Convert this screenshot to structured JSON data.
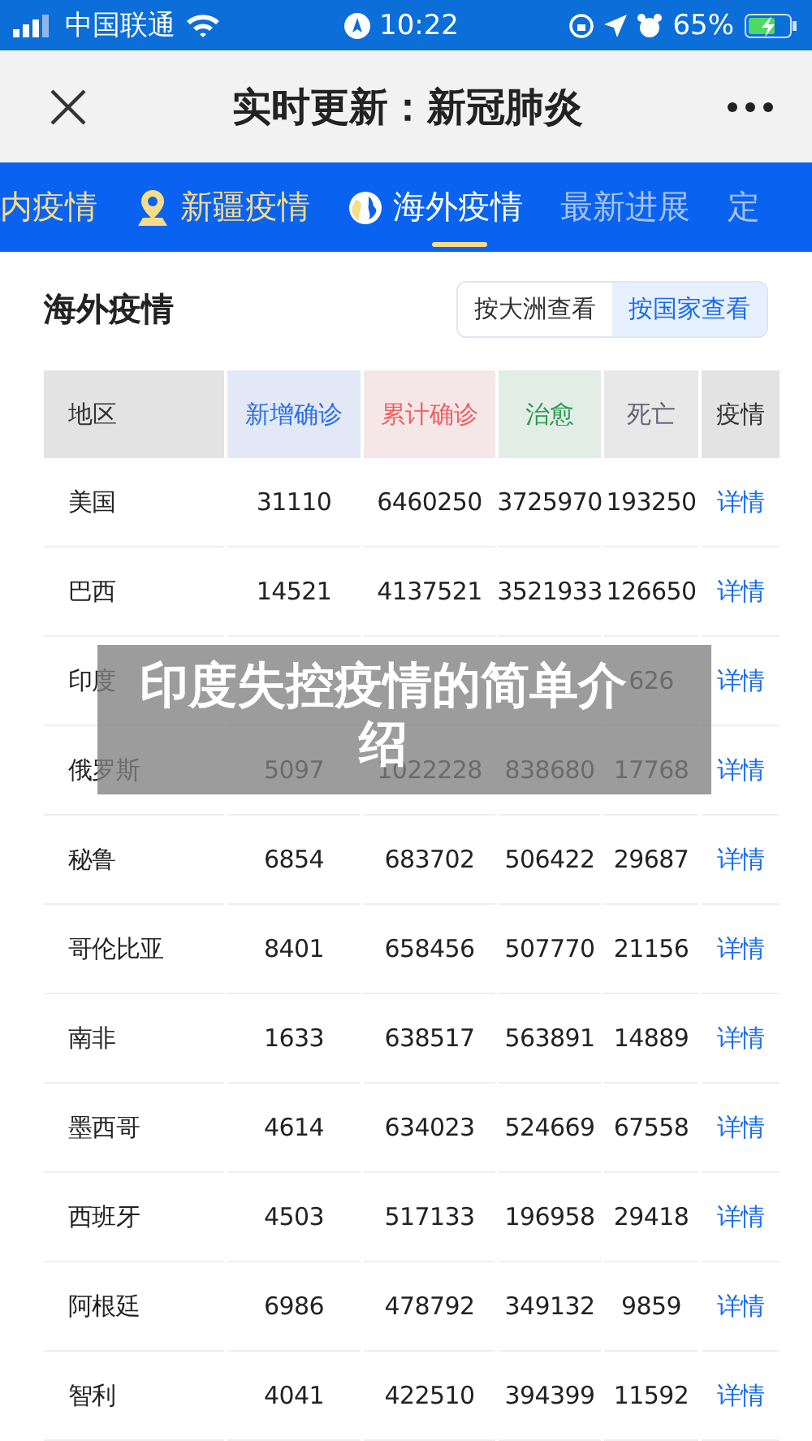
{
  "status_bar": {
    "carrier": "中国联通",
    "time": "10:22",
    "battery": "65%"
  },
  "nav": {
    "title": "实时更新：新冠肺炎"
  },
  "tabs": [
    {
      "label": "内疫情",
      "kind": "plain",
      "selected": false,
      "highlight": true
    },
    {
      "label": "新疆疫情",
      "kind": "pin",
      "selected": false,
      "highlight": true
    },
    {
      "label": "海外疫情",
      "kind": "globe",
      "selected": true,
      "highlight": false
    },
    {
      "label": "最新进展",
      "kind": "plain",
      "selected": false,
      "highlight": false
    },
    {
      "label": "定",
      "kind": "plain",
      "selected": false,
      "highlight": false
    }
  ],
  "section": {
    "title": "海外疫情",
    "toggle": [
      {
        "label": "按大洲查看",
        "selected": false
      },
      {
        "label": "按国家查看",
        "selected": true
      }
    ]
  },
  "table": {
    "columns": [
      {
        "label": "地区",
        "color": "#333333"
      },
      {
        "label": "新增确诊",
        "color": "#2a6ef0"
      },
      {
        "label": "累计确诊",
        "color": "#f06060"
      },
      {
        "label": "治愈",
        "color": "#2e9b54"
      },
      {
        "label": "死亡",
        "color": "#666677"
      },
      {
        "label": "疫情",
        "color": "#333333"
      }
    ],
    "rows": [
      {
        "cells": [
          "美国",
          "31110",
          "6460250",
          "3725970",
          "193250"
        ],
        "link": "详情"
      },
      {
        "cells": [
          "巴西",
          "14521",
          "4137521",
          "3521933",
          "126650"
        ],
        "link": "详情"
      },
      {
        "cells": [
          "印度",
          "",
          "",
          "",
          "626"
        ],
        "link": "详情"
      },
      {
        "cells": [
          "俄罗斯",
          "5097",
          "1022228",
          "838680",
          "17768"
        ],
        "link": "详情"
      },
      {
        "cells": [
          "秘鲁",
          "6854",
          "683702",
          "506422",
          "29687"
        ],
        "link": "详情"
      },
      {
        "cells": [
          "哥伦比亚",
          "8401",
          "658456",
          "507770",
          "21156"
        ],
        "link": "详情"
      },
      {
        "cells": [
          "南非",
          "1633",
          "638517",
          "563891",
          "14889"
        ],
        "link": "详情"
      },
      {
        "cells": [
          "墨西哥",
          "4614",
          "634023",
          "524669",
          "67558"
        ],
        "link": "详情"
      },
      {
        "cells": [
          "西班牙",
          "4503",
          "517133",
          "196958",
          "29418"
        ],
        "link": "详情"
      },
      {
        "cells": [
          "阿根廷",
          "6986",
          "478792",
          "349132",
          "9859"
        ],
        "link": "详情"
      },
      {
        "cells": [
          "智利",
          "4041",
          "422510",
          "394399",
          "11592"
        ],
        "link": "详情"
      }
    ]
  },
  "banner": {
    "text": "印度失控疫情的简单介绍"
  }
}
